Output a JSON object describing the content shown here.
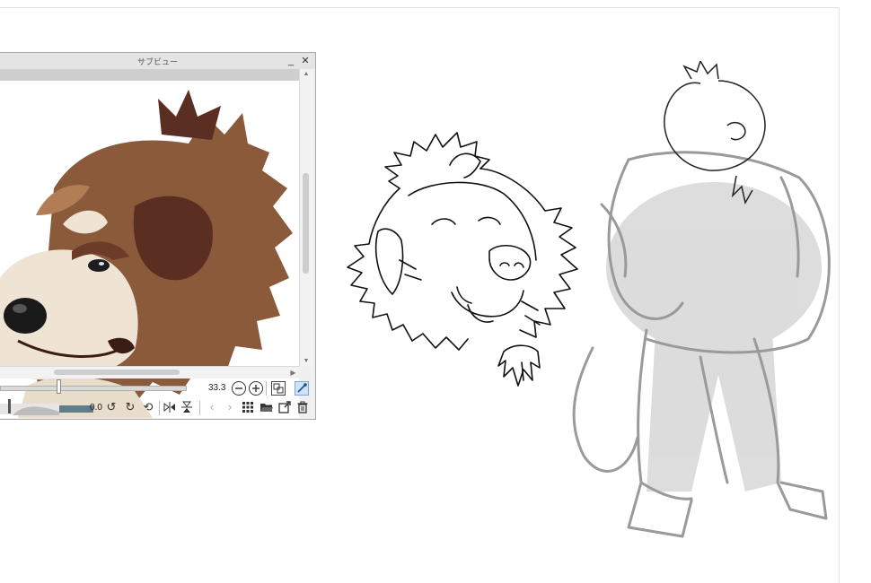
{
  "subview": {
    "title": "サブビュー",
    "minimize_label": "_",
    "close_label": "✕",
    "zoom_value": "33.3",
    "zoom_level": 0.3,
    "rotate_value": "0.0",
    "icons": {
      "zoom_out": "zoom-out-icon",
      "zoom_in": "zoom-in-icon",
      "fit": "fit-to-window-icon",
      "eyedropper": "eyedropper-icon",
      "rotate_left": "rotate-left-icon",
      "rotate_right": "rotate-right-icon",
      "reset_rotate": "reset-rotation-icon",
      "flip_horizontal": "flip-horizontal-icon",
      "flip_vertical": "flip-vertical-icon",
      "previous": "chevron-left-icon",
      "next": "chevron-right-icon",
      "grid": "grid-icon",
      "open_folder": "folder-open-icon",
      "export": "export-icon",
      "delete": "trash-icon"
    }
  },
  "colors": {
    "panel_bg": "#f0f0f0",
    "titlebar_bg": "#e4e4e4",
    "canvas_bg": "#ffffff",
    "fur_brown": "#8a5a3b",
    "fur_dark": "#5a2f22",
    "fur_light": "#efe3d3",
    "sketch_gray": "#9a9a9a",
    "line_black": "#111111"
  }
}
